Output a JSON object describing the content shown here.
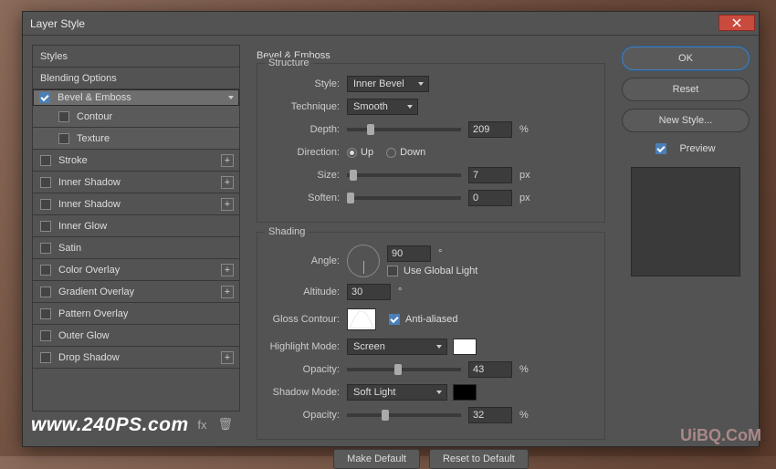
{
  "dialog": {
    "title": "Layer Style"
  },
  "left": {
    "styles": "Styles",
    "blending": "Blending Options",
    "bevel": "Bevel & Emboss",
    "contour": "Contour",
    "texture": "Texture",
    "stroke": "Stroke",
    "inner_shadow1": "Inner Shadow",
    "inner_shadow2": "Inner Shadow",
    "inner_glow": "Inner Glow",
    "satin": "Satin",
    "color_overlay": "Color Overlay",
    "gradient_overlay": "Gradient Overlay",
    "pattern_overlay": "Pattern Overlay",
    "outer_glow": "Outer Glow",
    "drop_shadow": "Drop Shadow"
  },
  "structure": {
    "title": "Bevel & Emboss",
    "group": "Structure",
    "style_lbl": "Style:",
    "style_val": "Inner Bevel",
    "tech_lbl": "Technique:",
    "tech_val": "Smooth",
    "depth_lbl": "Depth:",
    "depth_val": "209",
    "depth_unit": "%",
    "dir_lbl": "Direction:",
    "up": "Up",
    "down": "Down",
    "size_lbl": "Size:",
    "size_val": "7",
    "size_unit": "px",
    "soften_lbl": "Soften:",
    "soften_val": "0",
    "soften_unit": "px"
  },
  "shading": {
    "group": "Shading",
    "angle_lbl": "Angle:",
    "angle_val": "90",
    "angle_unit": "°",
    "global": "Use Global Light",
    "alt_lbl": "Altitude:",
    "alt_val": "30",
    "alt_unit": "°",
    "gloss_lbl": "Gloss Contour:",
    "aa": "Anti-aliased",
    "hl_lbl": "Highlight Mode:",
    "hl_val": "Screen",
    "hl_opacity_lbl": "Opacity:",
    "hl_opacity_val": "43",
    "hl_opacity_unit": "%",
    "sh_lbl": "Shadow Mode:",
    "sh_val": "Soft Light",
    "sh_opacity_lbl": "Opacity:",
    "sh_opacity_val": "32",
    "sh_opacity_unit": "%",
    "hl_color": "#ffffff",
    "sh_color": "#000000"
  },
  "buttons": {
    "make_default": "Make Default",
    "reset_default": "Reset to Default"
  },
  "right": {
    "ok": "OK",
    "reset": "Reset",
    "new_style": "New Style...",
    "preview": "Preview"
  },
  "watermark1": "www.240PS.com",
  "watermark2": "UiBQ.CoM"
}
